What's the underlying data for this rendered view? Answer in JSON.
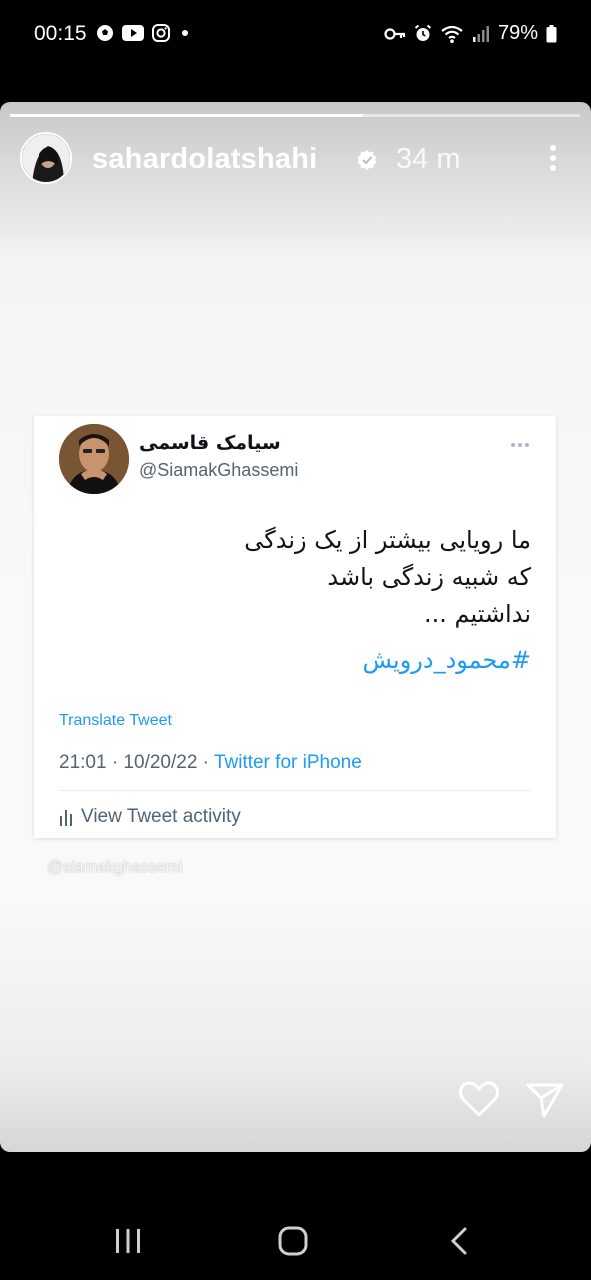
{
  "status_bar": {
    "time": "00:15",
    "left_icons": [
      "soccer-ball-icon",
      "youtube-icon",
      "instagram-icon",
      "dot-icon"
    ],
    "right_icons": [
      "vpn-key-icon",
      "alarm-icon",
      "wifi-icon",
      "signal-icon",
      "battery-icon"
    ],
    "battery_percent": "79%"
  },
  "story": {
    "progress": 0.62,
    "username": "sahardolatshahi",
    "verified": true,
    "time_ago": "34 m"
  },
  "tweet": {
    "display_name": "سیامک قاسمی",
    "handle": "@SiamakGhassemi",
    "text_lines": [
      "ما رویایی بیشتر از یک زندگی",
      "که شبیه زندگی باشد",
      "نداشتیم ..."
    ],
    "hashtag": "#محمود_درویش",
    "translate_label": "Translate Tweet",
    "timestamp": "21:01 · 10/20/22 · ",
    "source": "Twitter for iPhone",
    "activity_label": "View Tweet activity"
  },
  "watermark": "@siamakghassemi",
  "colors": {
    "twitter_blue": "#1d9bf0",
    "text_primary": "#0f1419",
    "text_secondary": "#536471"
  }
}
